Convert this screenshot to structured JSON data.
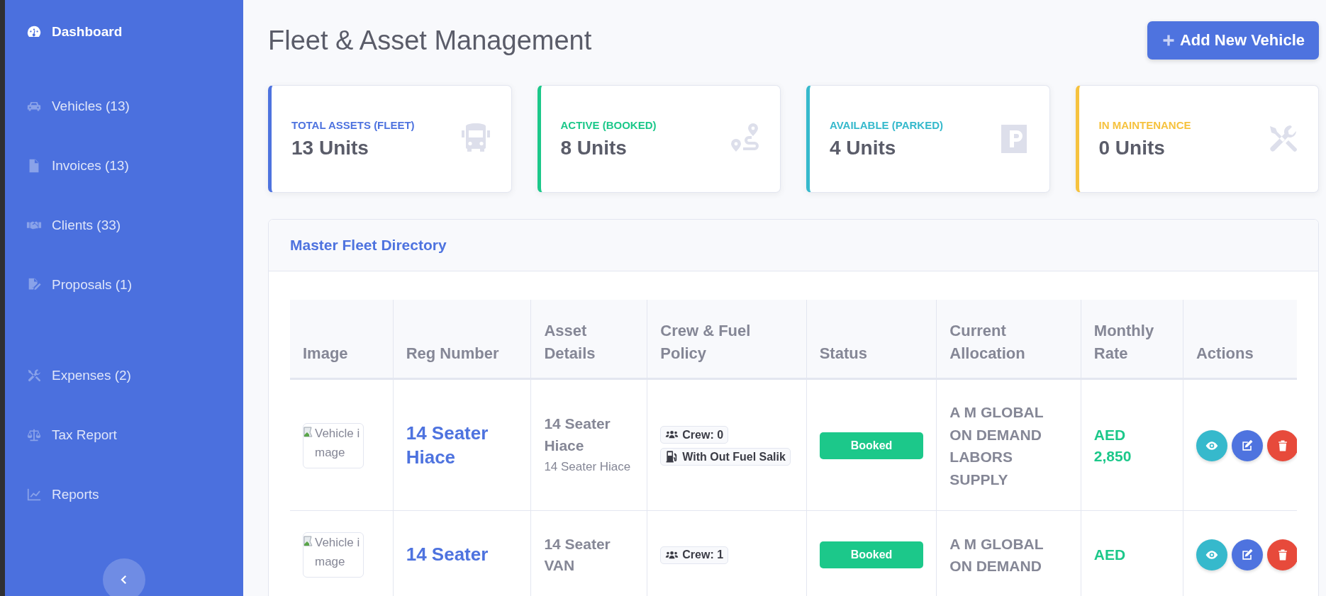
{
  "sidebar": {
    "groups": [
      {
        "items": [
          {
            "kind": "gauge",
            "label": "Dashboard",
            "selected": true
          }
        ]
      },
      {
        "items": [
          {
            "kind": "car",
            "label": "Vehicles (13)",
            "selected": false
          },
          {
            "kind": "invoice",
            "label": "Invoices (13)",
            "selected": false
          },
          {
            "kind": "handshake",
            "label": "Clients (33)",
            "selected": false
          },
          {
            "kind": "signature",
            "label": "Proposals (1)",
            "selected": false
          }
        ]
      },
      {
        "items": [
          {
            "kind": "tools",
            "label": "Expenses (2)",
            "selected": false
          },
          {
            "kind": "scale",
            "label": "Tax Report",
            "selected": false
          },
          {
            "kind": "chart",
            "label": "Reports",
            "selected": false
          }
        ]
      }
    ]
  },
  "page": {
    "title": "Fleet & Asset Management",
    "add_button": "Add New Vehicle"
  },
  "stats": [
    {
      "label": "TOTAL ASSETS (FLEET)",
      "value": "13 Units",
      "color": "#4e73df",
      "kind": "bus"
    },
    {
      "label": "ACTIVE (BOOKED)",
      "value": "8 Units",
      "color": "#1cc88a",
      "kind": "route"
    },
    {
      "label": "AVAILABLE (PARKED)",
      "value": "4 Units",
      "color": "#36b9cc",
      "kind": "parking"
    },
    {
      "label": "IN MAINTENANCE",
      "value": "0 Units",
      "color": "#f6c23e",
      "kind": "tools"
    }
  ],
  "directory": {
    "title": "Master Fleet Directory",
    "columns": [
      "Image",
      "Reg Number",
      "Asset Details",
      "Crew & Fuel Policy",
      "Status",
      "Current Allocation",
      "Monthly Rate",
      "Actions"
    ],
    "rows": [
      {
        "image_alt": "Vehicle image",
        "reg": "14 Seater Hiace",
        "asset_title": "14 Seater Hiace",
        "asset_sub": "14 Seater Hiace",
        "crew": "Crew: 0",
        "fuel": "With Out Fuel Salik",
        "status": {
          "kind": "booked",
          "label": "Booked"
        },
        "allocation": "A M GLOBAL ON DEMAND LABORS SUPPLY",
        "rate": "AED 2,850"
      },
      {
        "image_alt": "Vehicle image",
        "reg": "14 Seater",
        "asset_title": "14 Seater VAN",
        "crew": "Crew: 1",
        "status": {
          "kind": "booked",
          "label": "Booked"
        },
        "allocation": "A M GLOBAL ON DEMAND",
        "rate": "AED"
      }
    ]
  }
}
